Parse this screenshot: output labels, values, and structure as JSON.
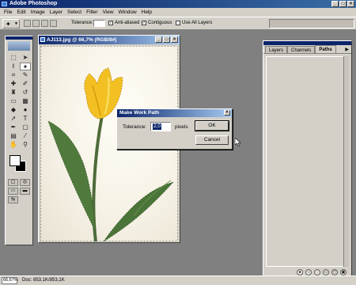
{
  "app": {
    "title": "Adobe Photoshop"
  },
  "menu": [
    "File",
    "Edit",
    "Image",
    "Layer",
    "Select",
    "Filter",
    "View",
    "Window",
    "Help"
  ],
  "options": {
    "tolerance_label": "Tolerance:",
    "tolerance_value": "",
    "anti_aliased": "Anti-aliased",
    "contiguous": "Contiguous",
    "use_all_layers": "Use All Layers"
  },
  "document": {
    "title": "AJ113.jpg @ 66,7% (RGB/8#)"
  },
  "palette": {
    "tabs": [
      "Layers",
      "Channels",
      "Paths"
    ],
    "active_tab": "Paths"
  },
  "dialog": {
    "title": "Make Work Path",
    "tolerance_label": "Tolerance:",
    "tolerance_value": "2,0",
    "unit": "pixels",
    "ok_label": "OK",
    "cancel_label": "Cancel"
  },
  "status": {
    "zoom": "66,67%",
    "doc_info": "Doc: 853,1K/853,1K"
  },
  "colors": {
    "titlebar": "#0a246a",
    "chrome": "#d4d0c8",
    "workspace": "#808080"
  }
}
